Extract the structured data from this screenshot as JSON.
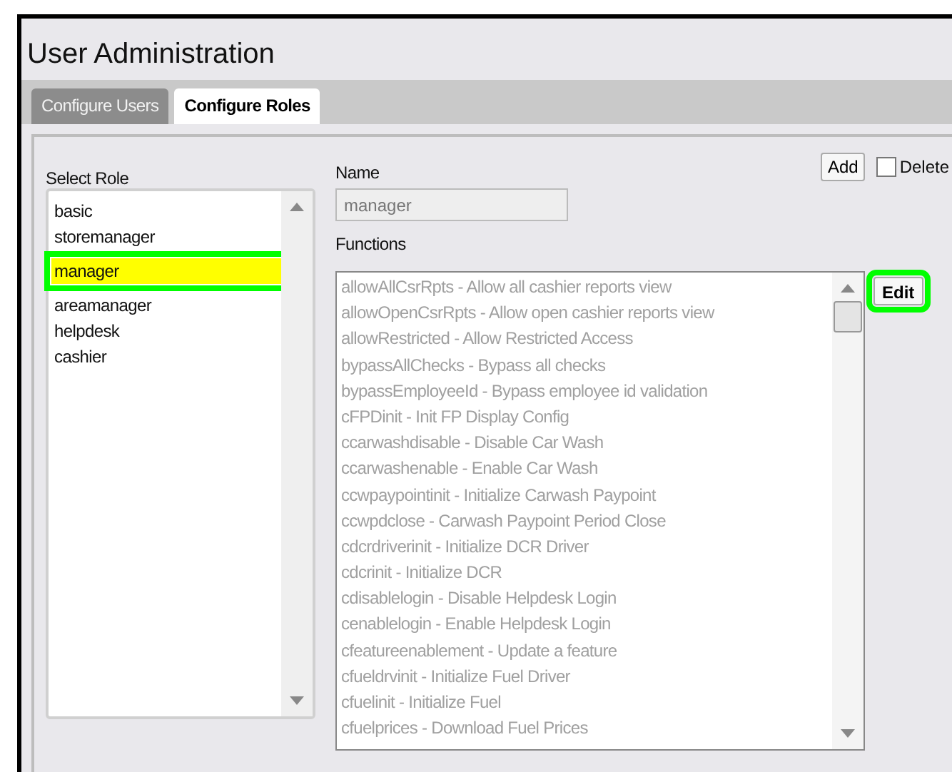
{
  "window": {
    "title": "User Administration"
  },
  "tabs": [
    {
      "label": "Configure Users",
      "selected": false
    },
    {
      "label": "Configure Roles",
      "selected": true
    }
  ],
  "toolbar": {
    "add_button": "Add",
    "delete_checkbox": {
      "label": "Delete",
      "checked": false
    }
  },
  "roles": {
    "label": "Select Role",
    "items": [
      {
        "name": "basic",
        "selected": false
      },
      {
        "name": "storemanager",
        "selected": false
      },
      {
        "name": "manager",
        "selected": true
      },
      {
        "name": "areamanager",
        "selected": false
      },
      {
        "name": "helpdesk",
        "selected": false
      },
      {
        "name": "cashier",
        "selected": false
      }
    ]
  },
  "name_field": {
    "label": "Name",
    "value": "manager",
    "disabled": true
  },
  "functions": {
    "label": "Functions",
    "disabled": true,
    "items": [
      "allowAllCsrRpts - Allow all cashier reports view",
      "allowOpenCsrRpts - Allow open cashier reports view",
      "allowRestricted - Allow Restricted Access",
      "bypassAllChecks - Bypass all checks",
      "bypassEmployeeId - Bypass employee id validation",
      "cFPDinit - Init FP Display Config",
      "ccarwashdisable - Disable Car Wash",
      "ccarwashenable - Enable Car Wash",
      "ccwpaypointinit - Initialize Carwash Paypoint",
      "ccwpdclose - Carwash Paypoint Period Close",
      "cdcrdriverinit - Initialize DCR Driver",
      "cdcrinit - Initialize DCR",
      "cdisablelogin - Disable Helpdesk Login",
      "cenablelogin - Enable Helpdesk Login",
      "cfeatureenablement - Update a feature",
      "cfueldrvinit - Initialize Fuel Driver",
      "cfuelinit - Initialize Fuel",
      "cfuelprices - Download Fuel Prices"
    ]
  },
  "edit_button": {
    "label": "Edit",
    "highlighted": true
  }
}
